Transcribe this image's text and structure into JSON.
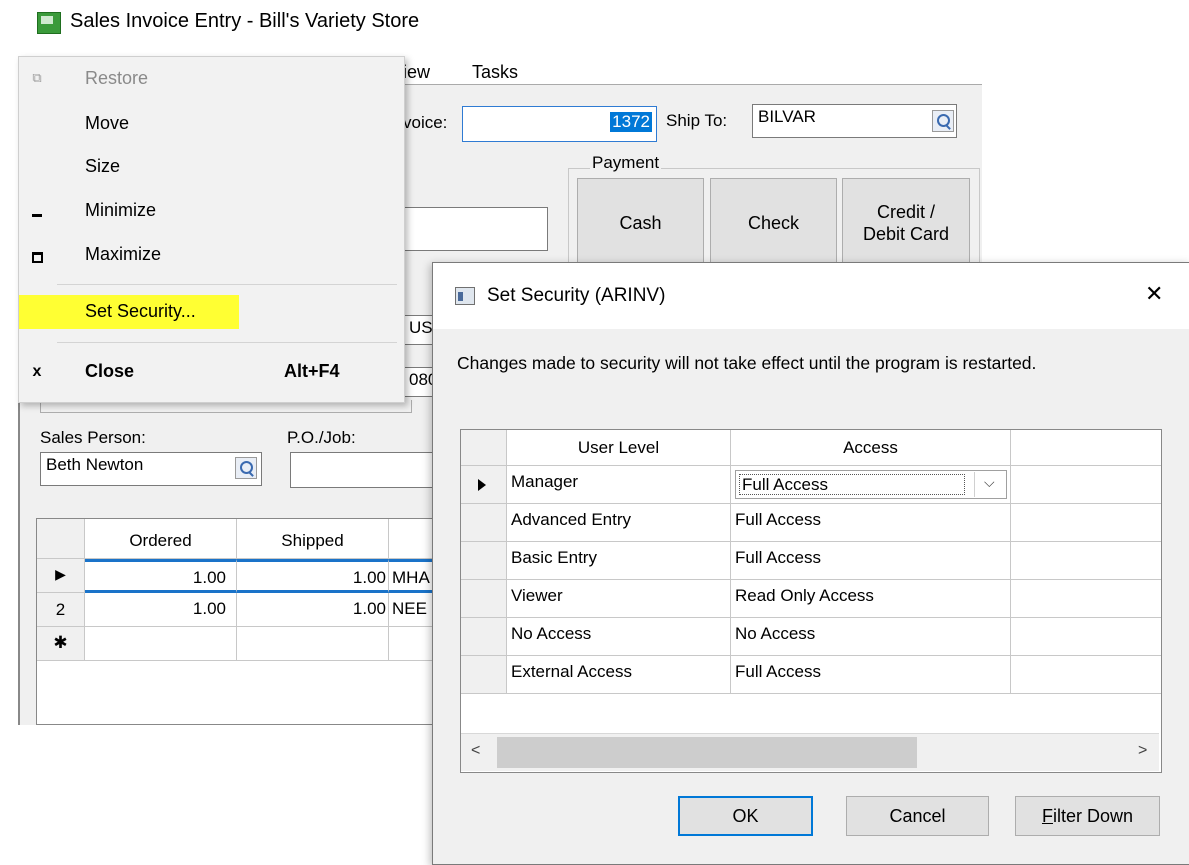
{
  "window": {
    "title": "Sales Invoice Entry - Bill's Variety Store"
  },
  "menubar": {
    "view_partial": "iew",
    "tasks": "Tasks"
  },
  "invoice": {
    "label_partial": "voice:",
    "number": "1372",
    "ship_to_label": "Ship To:",
    "ship_to_value": "BILVAR",
    "partial_text_1": "US",
    "partial_text_2": "080"
  },
  "payment": {
    "legend": "Payment",
    "buttons": [
      {
        "label": "Cash"
      },
      {
        "label": "Check"
      },
      {
        "label_line1": "Credit /",
        "label_line2": "Debit Card"
      }
    ]
  },
  "sales_person": {
    "label": "Sales Person:",
    "value": "Beth Newton"
  },
  "po_job": {
    "label": "P.O./Job:",
    "value": ""
  },
  "lines_grid": {
    "columns": [
      "Ordered",
      "Shipped"
    ],
    "rows": [
      {
        "indicator": "▶",
        "ordered": "1.00",
        "shipped": "1.00",
        "item_partial": "MHA"
      },
      {
        "indicator": "2",
        "ordered": "1.00",
        "shipped": "1.00",
        "item_partial": "NEE"
      },
      {
        "indicator": "✱",
        "ordered": "",
        "shipped": "",
        "item_partial": ""
      }
    ]
  },
  "system_menu": {
    "items": [
      {
        "icon": "restore-icon",
        "label": "Restore",
        "enabled": false
      },
      {
        "icon": "",
        "label": "Move",
        "enabled": true
      },
      {
        "icon": "",
        "label": "Size",
        "enabled": true
      },
      {
        "icon": "minimize-icon",
        "label": "Minimize",
        "enabled": true
      },
      {
        "icon": "maximize-icon",
        "label": "Maximize",
        "enabled": true
      },
      {
        "icon": "",
        "label": "Set Security...",
        "enabled": true,
        "highlight_color": "#ffff33"
      },
      {
        "icon": "close-icon",
        "label": "Close",
        "shortcut": "Alt+F4",
        "enabled": true
      }
    ]
  },
  "dialog": {
    "title": "Set Security  (ARINV)",
    "close_glyph": "✕",
    "message": "Changes made to security will not take effect until the program is restarted.",
    "grid": {
      "columns": [
        "User Level",
        "Access"
      ],
      "rows": [
        {
          "level": "Manager",
          "access": "Full Access",
          "current": true
        },
        {
          "level": "Advanced Entry",
          "access": "Full Access"
        },
        {
          "level": "Basic Entry",
          "access": "Full Access"
        },
        {
          "level": "Viewer",
          "access": "Read Only Access"
        },
        {
          "level": "No Access",
          "access": "No Access"
        },
        {
          "level": "External Access",
          "access": "Full Access"
        }
      ]
    },
    "buttons": {
      "ok": "OK",
      "cancel": "Cancel",
      "filter_down": "Filter Down"
    }
  },
  "colors": {
    "highlight": "#ffff33",
    "selection": "#0078d7",
    "row_rule": "#1a73c9"
  }
}
